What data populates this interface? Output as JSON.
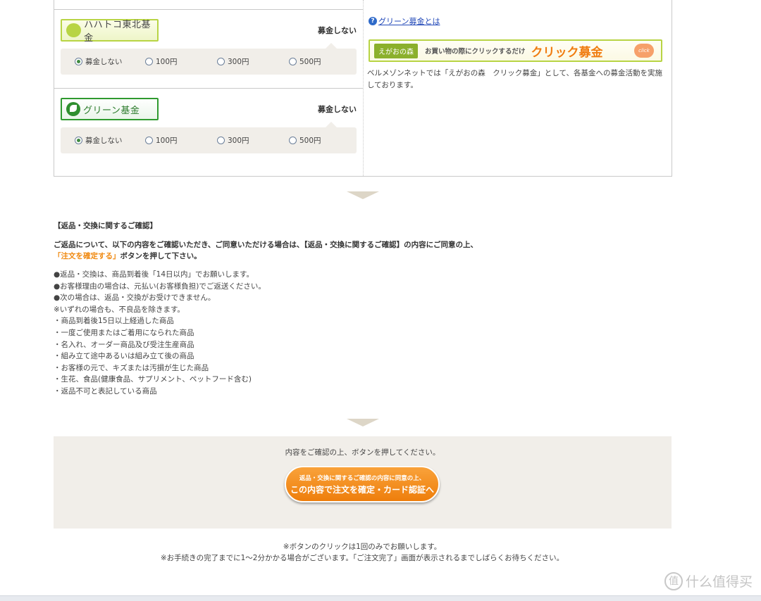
{
  "funds": [
    {
      "name": "ハハトコ東北基金",
      "status": "募金しない",
      "options": [
        "募金しない",
        "100円",
        "300円",
        "500円"
      ],
      "selected": 0
    },
    {
      "name": "グリーン基金",
      "status": "募金しない",
      "options": [
        "募金しない",
        "100円",
        "300円",
        "500円"
      ],
      "selected": 0
    }
  ],
  "right_panel": {
    "help_link": "グリーン募金とは",
    "banner": {
      "logo": "えがおの森",
      "sub": "お買い物の際にクリックするだけ",
      "main": "クリック募金",
      "badge": "click"
    },
    "description": "ベルメゾンネットでは「えがおの森　クリック募金」として、各基金への募金活動を実施しております。"
  },
  "returns": {
    "title": "【返品・交換に関するご確認】",
    "intro_line1": "ご返品について、以下の内容をご確認いただき、ご同意いただける場合は、【返品・交換に関するご確認】の内容にご同意の上、",
    "intro_highlight": "「注文を確定する」",
    "intro_line2": "ボタンを押して下さい。",
    "rules": [
      "●返品・交換は、商品到着後「14日以内」でお願いします。",
      "●お客様理由の場合は、元払い(お客様負担)でご返送ください。",
      "●次の場合は、返品・交換がお受けできません。",
      "※いずれの場合も、不良品を除きます。",
      "・商品到着後15日以上経過した商品",
      "・一度ご使用またはご着用になられた商品",
      "・名入れ、オーダー商品及び受注生産商品",
      "・組み立て途中あるいは組み立て後の商品",
      "・お客様の元で、キズまたは汚損が生じた商品",
      "・生花、食品(健康食品、サプリメント、ペットフード含む)",
      "・返品不可と表記している商品"
    ]
  },
  "confirm": {
    "hint": "内容をご確認の上、ボタンを押してください。",
    "button_small": "返品・交換に関するご確認の内容に同意の上、",
    "button_big": "この内容で注文を確定・カード認証へ"
  },
  "notes": [
    "※ボタンのクリックは1回のみでお願いします。",
    "※お手続きの完了までに1～2分かかる場合がございます。「ご注文完了」画面が表示されるまでしばらくお待ちください。"
  ],
  "watermark": {
    "icon": "值",
    "text": "什么值得买"
  }
}
